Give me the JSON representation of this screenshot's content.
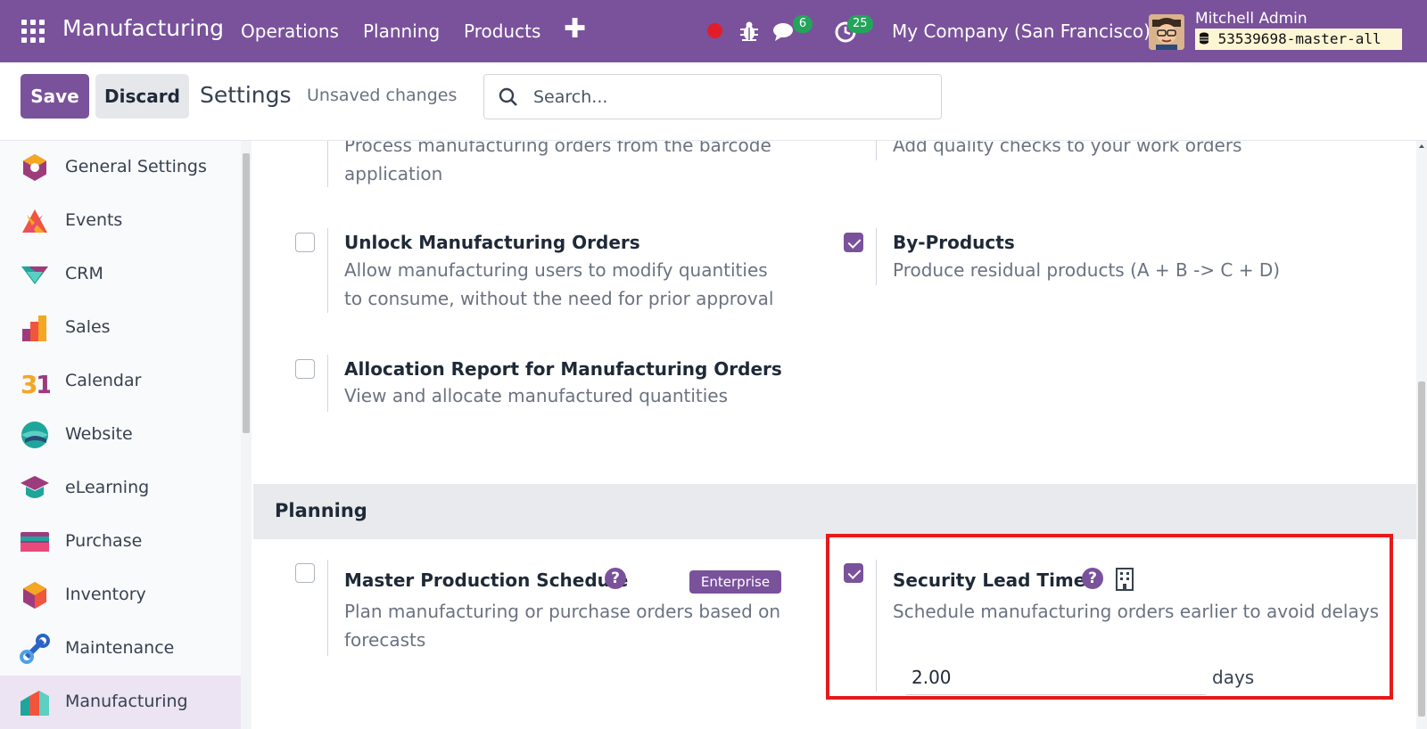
{
  "navbar": {
    "brand": "Manufacturing",
    "menus": [
      "Operations",
      "Planning",
      "Products"
    ],
    "plus_icon": "plus-icon",
    "messages_count": "6",
    "activities_count": "25",
    "company": "My Company (San Francisco)",
    "user_name": "Mitchell Admin",
    "db_name": "53539698-master-all",
    "accent_color": "#7a529b"
  },
  "control": {
    "save_label": "Save",
    "discard_label": "Discard",
    "title": "Settings",
    "status": "Unsaved changes",
    "search_placeholder": "Search..."
  },
  "sidebar": {
    "items": [
      {
        "label": "General Settings",
        "icon": "general-settings-icon"
      },
      {
        "label": "Events",
        "icon": "events-icon"
      },
      {
        "label": "CRM",
        "icon": "crm-icon"
      },
      {
        "label": "Sales",
        "icon": "sales-icon"
      },
      {
        "label": "Calendar",
        "icon": "calendar-icon"
      },
      {
        "label": "Website",
        "icon": "website-icon"
      },
      {
        "label": "eLearning",
        "icon": "elearning-icon"
      },
      {
        "label": "Purchase",
        "icon": "purchase-icon"
      },
      {
        "label": "Inventory",
        "icon": "inventory-icon"
      },
      {
        "label": "Maintenance",
        "icon": "maintenance-icon"
      },
      {
        "label": "Manufacturing",
        "icon": "manufacturing-icon",
        "active": true
      }
    ]
  },
  "settings": {
    "barcode_desc": "Process manufacturing orders from the barcode application",
    "quality_desc": "Add quality checks to your work orders",
    "unlock": {
      "title": "Unlock Manufacturing Orders",
      "desc": "Allow manufacturing users to modify quantities to consume, without the need for prior approval",
      "checked": false
    },
    "byproducts": {
      "title": "By-Products",
      "desc": "Produce residual products (A + B -> C + D)",
      "checked": true
    },
    "allocation": {
      "title": "Allocation Report for Manufacturing Orders",
      "desc": "View and allocate manufactured quantities",
      "checked": false
    },
    "planning_section": "Planning",
    "mps": {
      "title": "Master Production Schedule",
      "desc": "Plan manufacturing or purchase orders based on forecasts",
      "badge": "Enterprise",
      "checked": false
    },
    "lead_time": {
      "title": "Security Lead Time",
      "desc": "Schedule manufacturing orders earlier to avoid delays",
      "value": "2.00",
      "unit": "days",
      "checked": true
    },
    "help_glyph": "?"
  }
}
